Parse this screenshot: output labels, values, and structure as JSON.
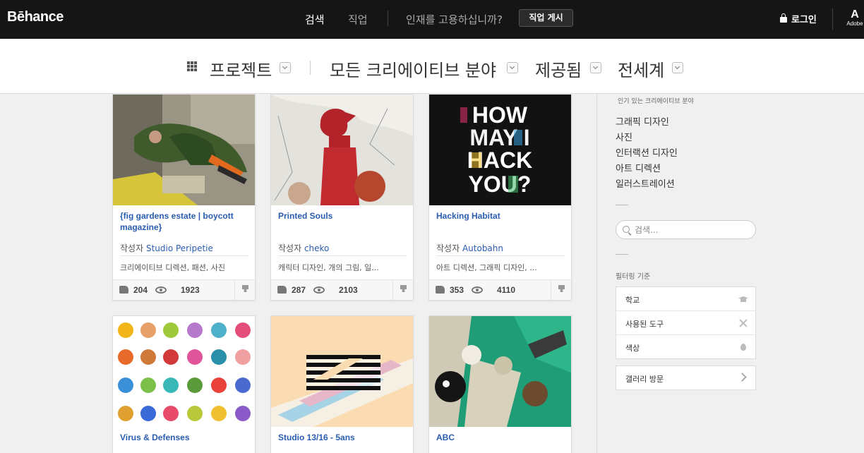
{
  "header": {
    "logo": "Bēhance",
    "nav": {
      "search": "검색",
      "jobs": "직업"
    },
    "hire_question": "인재를 고용하십니까?",
    "post_job": "직업 게시",
    "login": "로그인",
    "adobe_mark": "A",
    "adobe_text": "Adobe"
  },
  "filters": {
    "projects": "프로젝트",
    "creative_fields": "모든 크리에이티브 분야",
    "featured": "제공됨",
    "location": "전세계"
  },
  "projects": [
    {
      "title": "{fig gardens estate | boycott magazine}",
      "author_prefix": "작성자",
      "author": "Studio Peripetie",
      "fields": "크리에이티브 디렉션, 패션, 사진",
      "likes": "204",
      "views": "1923"
    },
    {
      "title": "Printed Souls",
      "author_prefix": "작성자",
      "author": "cheko",
      "fields": "캐릭터 디자인, 개의 그림, 일...",
      "likes": "287",
      "views": "2103"
    },
    {
      "title": "Hacking Habitat",
      "author_prefix": "작성자",
      "author": "Autobahn",
      "fields": "아트 디렉션, 그래픽 디자인, ...",
      "likes": "353",
      "views": "4110",
      "thumb_text": [
        "HOW",
        "MAY I",
        "HACK",
        "YOU?"
      ]
    },
    {
      "title": "Virus & Defenses"
    },
    {
      "title": "Studio 13/16 - 5ans"
    },
    {
      "title": "ABC"
    }
  ],
  "sidebar": {
    "popular_heading": "인기 있는 크리에이티브 분야",
    "popular_fields": [
      "그래픽 디자인",
      "사진",
      "인터랙션 디자인",
      "아트 디렉션",
      "일러스트레이션"
    ],
    "search_placeholder": "검색...",
    "filter_by": "필터링 기준",
    "filter_items": [
      "학교",
      "사용된 도구",
      "색상"
    ],
    "gallery": "갤러리 방문"
  },
  "colors": {
    "link": "#2a5db0",
    "topbar": "#151515"
  },
  "icons": [
    "lock-icon",
    "grid-icon",
    "chevron-down-icon",
    "thumbs-up-icon",
    "eye-icon",
    "appreciate-icon",
    "search-icon",
    "graduation-cap-icon",
    "tools-icon",
    "drop-icon",
    "chevron-right-icon"
  ]
}
